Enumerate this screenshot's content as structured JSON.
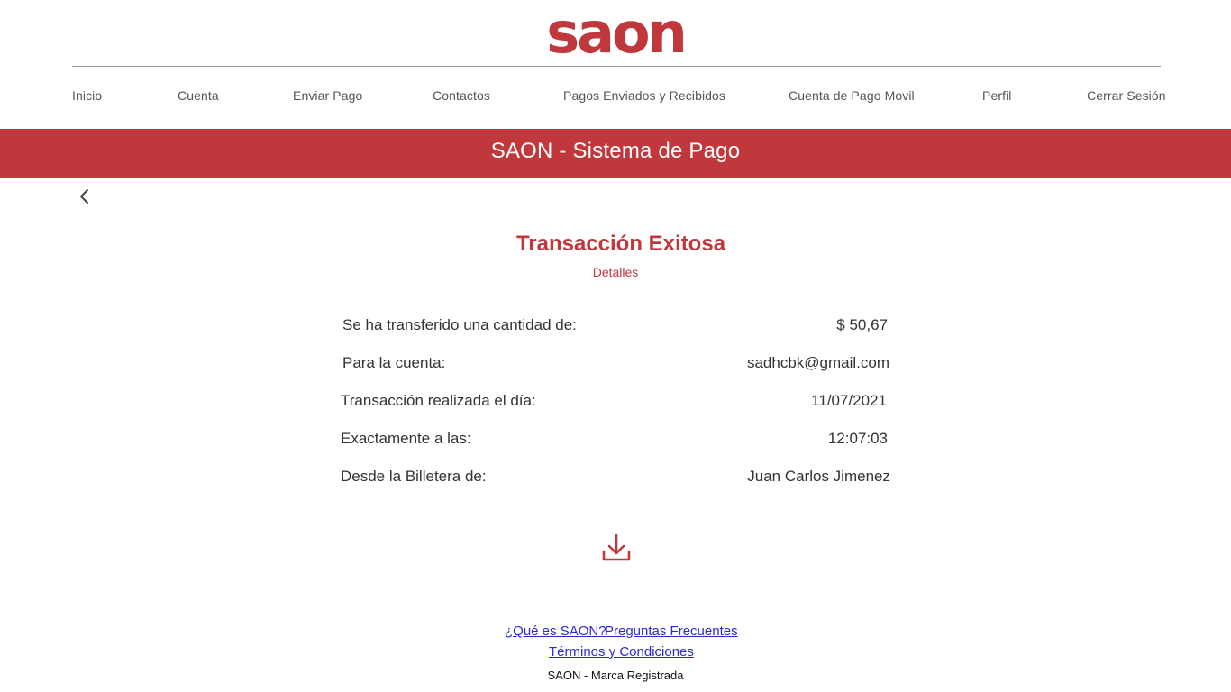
{
  "brand": {
    "logo_text": "saon",
    "accent": "#c0383c"
  },
  "nav": {
    "items": [
      {
        "label": "Inicio"
      },
      {
        "label": "Cuenta"
      },
      {
        "label": "Enviar Pago"
      },
      {
        "label": "Contactos"
      },
      {
        "label": "Pagos Enviados y Recibidos"
      },
      {
        "label": "Cuenta de Pago Movil"
      },
      {
        "label": "Perfil"
      },
      {
        "label": "Cerrar Sesión"
      }
    ]
  },
  "banner": {
    "title": "SAON - Sistema de Pago"
  },
  "back": {
    "icon": "chevron-left-icon"
  },
  "result": {
    "title": "Transacción Exitosa",
    "subtitle": "Detalles",
    "rows": [
      {
        "label": "Se ha transferido una cantidad de:",
        "value": "$ 50,67"
      },
      {
        "label": "Para la cuenta:",
        "value": "sadhcbk@gmail.com"
      },
      {
        "label": "Transacción realizada el día:",
        "value": "11/07/2021"
      },
      {
        "label": "Exactamente a las:",
        "value": "12:07:03"
      },
      {
        "label": "Desde la Billetera de:",
        "value": "Juan Carlos Jimenez"
      }
    ]
  },
  "download": {
    "icon": "download-icon"
  },
  "footer": {
    "links": [
      {
        "label": "¿Qué es SAON?"
      },
      {
        "label": "Preguntas Frecuentes"
      },
      {
        "label": "Términos y Condiciones"
      }
    ],
    "trademark": "SAON - Marca Registrada"
  }
}
